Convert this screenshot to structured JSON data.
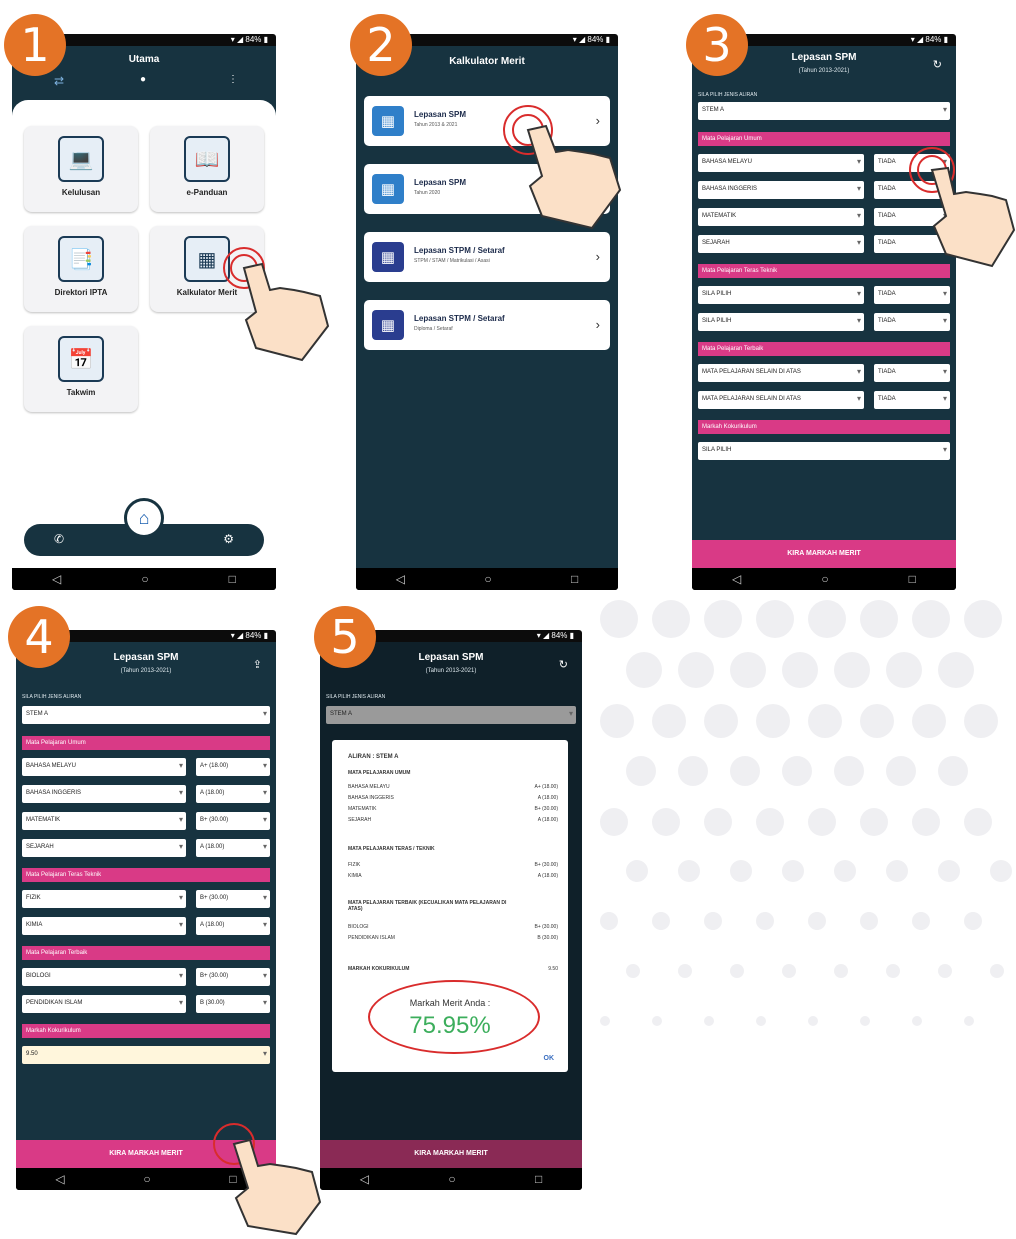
{
  "steps": [
    "1",
    "2",
    "3",
    "4",
    "5"
  ],
  "status_text": "▾ ◢ 84% ▮",
  "nav": {
    "back": "◁",
    "home": "○",
    "recent": "□"
  },
  "screen1": {
    "title": "Utama",
    "tiles": [
      {
        "label": "Kelulusan",
        "icon": "laptop-icon"
      },
      {
        "label": "e-Panduan",
        "icon": "book-icon"
      },
      {
        "label": "Direktori IPTA",
        "icon": "directory-icon"
      },
      {
        "label": "Kalkulator Merit",
        "icon": "calculator-icon"
      },
      {
        "label": "Takwim",
        "icon": "calendar-icon"
      }
    ],
    "bottom_nav": {
      "phone": "✆",
      "home": "⌂",
      "settings": "⚙"
    }
  },
  "screen2": {
    "title": "Kalkulator Merit",
    "cards": [
      {
        "title": "Lepasan SPM",
        "sub": "Tahun 2013 & 2021",
        "color": "#2f7fc9"
      },
      {
        "title": "Lepasan SPM",
        "sub": "Tahun 2020",
        "color": "#2f7fc9"
      },
      {
        "title": "Lepasan STPM / Setaraf",
        "sub": "STPM / STAM / Matrikulasi / Asasi",
        "color": "#2a3d8f"
      },
      {
        "title": "Lepasan STPM / Setaraf",
        "sub": "Diploma / Setaraf",
        "color": "#2a3d8f"
      }
    ]
  },
  "screen3": {
    "title": "Lepasan SPM",
    "subtitle": "(Tahun 2013-2021)",
    "aliran_label": "SILA PILIH JENIS ALIRAN",
    "aliran_value": "STEM A",
    "sections": [
      {
        "header": "Mata Pelajaran Umum",
        "rows": [
          [
            "BAHASA MELAYU",
            "TIADA"
          ],
          [
            "BAHASA INGGERIS",
            "TIADA"
          ],
          [
            "MATEMATIK",
            "TIADA"
          ],
          [
            "SEJARAH",
            "TIADA"
          ]
        ]
      },
      {
        "header": "Mata Pelajaran Teras Teknik",
        "rows": [
          [
            "SILA PILIH",
            "TIADA"
          ],
          [
            "SILA PILIH",
            "TIADA"
          ]
        ]
      },
      {
        "header": "Mata Pelajaran Terbaik",
        "rows": [
          [
            "MATA PELAJARAN SELAIN DI ATAS",
            "TIADA"
          ],
          [
            "MATA PELAJARAN SELAIN DI ATAS",
            "TIADA"
          ]
        ]
      },
      {
        "header": "Markah Kokurikulum",
        "rows": [
          [
            "SILA PILIH",
            ""
          ]
        ]
      }
    ],
    "button": "KIRA MARKAH MERIT"
  },
  "screen4": {
    "title": "Lepasan SPM",
    "subtitle": "(Tahun 2013-2021)",
    "aliran_label": "SILA PILIH JENIS ALIRAN",
    "aliran_value": "STEM A",
    "sections": [
      {
        "header": "Mata Pelajaran Umum",
        "rows": [
          [
            "BAHASA MELAYU",
            "A+ (18.00)"
          ],
          [
            "BAHASA INGGERIS",
            "A (18.00)"
          ],
          [
            "MATEMATIK",
            "B+ (30.00)"
          ],
          [
            "SEJARAH",
            "A (18.00)"
          ]
        ]
      },
      {
        "header": "Mata Pelajaran Teras Teknik",
        "rows": [
          [
            "FIZIK",
            "B+ (30.00)"
          ],
          [
            "KIMIA",
            "A (18.00)"
          ]
        ]
      },
      {
        "header": "Mata Pelajaran Terbaik",
        "rows": [
          [
            "BIOLOGI",
            "B+ (30.00)"
          ],
          [
            "PENDIDIKAN ISLAM",
            "B (30.00)"
          ]
        ]
      },
      {
        "header": "Markah Kokurikulum",
        "rows": [
          [
            "9.50",
            ""
          ]
        ]
      }
    ],
    "button": "KIRA MARKAH MERIT"
  },
  "screen5": {
    "title": "Lepasan SPM",
    "subtitle": "(Tahun 2013-2021)",
    "aliran_label": "SILA PILIH JENIS ALIRAN",
    "aliran_value": "STEM A",
    "modal": {
      "heading": "ALIRAN : STEM A",
      "s1": "MATA PELAJARAN UMUM",
      "s1_rows": [
        [
          "BAHASA MELAYU",
          "A+ (18.00)"
        ],
        [
          "BAHASA INGGERIS",
          "A (18.00)"
        ],
        [
          "MATEMATIK",
          "B+ (30.00)"
        ],
        [
          "SEJARAH",
          "A (18.00)"
        ]
      ],
      "s2": "MATA PELAJARAN TERAS / TEKNIK",
      "s2_rows": [
        [
          "FIZIK",
          "B+ (30.00)"
        ],
        [
          "KIMIA",
          "A (18.00)"
        ]
      ],
      "s3": "MATA PELAJARAN TERBAIK (KECUALIKAN MATA PELAJARAN DI ATAS)",
      "s3_rows": [
        [
          "BIOLOGI",
          "B+ (30.00)"
        ],
        [
          "PENDIDIKAN ISLAM",
          "B (30.00)"
        ]
      ],
      "koku_label": "MARKAH KOKURIKULUM",
      "koku_value": "9.50",
      "result_label": "Markah Merit Anda :",
      "result_value": "75.95%",
      "ok": "OK"
    },
    "button": "KIRA MARKAH MERIT"
  }
}
